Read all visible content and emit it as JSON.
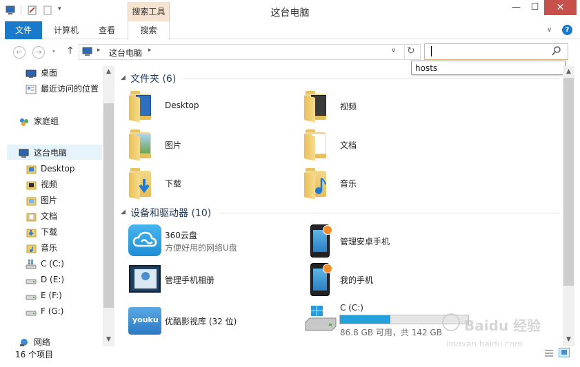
{
  "window": {
    "title": "这台电脑",
    "contextual_tab_group": "搜索工具",
    "controls": {
      "minimize": "—",
      "maximize": "☐",
      "close": "✕"
    }
  },
  "ribbon": {
    "tabs": [
      {
        "label": "文件"
      },
      {
        "label": "计算机"
      },
      {
        "label": "查看"
      },
      {
        "label": "搜索"
      }
    ],
    "help_icon": "?"
  },
  "address": {
    "breadcrumb": [
      "这台电脑"
    ],
    "search_value": "",
    "search_suggestion": "hosts"
  },
  "nav_pane": {
    "items": [
      {
        "label": "桌面",
        "icon": "desktop-icon"
      },
      {
        "label": "最近访问的位置",
        "icon": "recent-places-icon"
      },
      {
        "label": "家庭组",
        "icon": "homegroup-icon"
      },
      {
        "label": "这台电脑",
        "icon": "computer-icon",
        "selected": true
      },
      {
        "label": "Desktop",
        "icon": "folder-icon"
      },
      {
        "label": "视频",
        "icon": "video-folder-icon"
      },
      {
        "label": "图片",
        "icon": "pictures-folder-icon"
      },
      {
        "label": "文档",
        "icon": "documents-folder-icon"
      },
      {
        "label": "下载",
        "icon": "downloads-folder-icon"
      },
      {
        "label": "音乐",
        "icon": "music-folder-icon"
      },
      {
        "label": "C (C:)",
        "icon": "windows-drive-icon"
      },
      {
        "label": "D (E:)",
        "icon": "drive-icon"
      },
      {
        "label": "E (F:)",
        "icon": "drive-icon"
      },
      {
        "label": "F (G:)",
        "icon": "drive-icon"
      },
      {
        "label": "网络",
        "icon": "network-icon"
      }
    ]
  },
  "content": {
    "folders_group": {
      "title": "文件夹 (6)",
      "items": [
        {
          "label": "Desktop",
          "icon": "desktop-folder-icon"
        },
        {
          "label": "视频",
          "icon": "video-folder-icon"
        },
        {
          "label": "图片",
          "icon": "pictures-folder-icon"
        },
        {
          "label": "文档",
          "icon": "documents-folder-icon"
        },
        {
          "label": "下载",
          "icon": "downloads-folder-icon"
        },
        {
          "label": "音乐",
          "icon": "music-folder-icon"
        }
      ]
    },
    "devices_group": {
      "title": "设备和驱动器 (10)",
      "items": [
        {
          "label": "360云盘",
          "sub": "方便好用的网络U盘",
          "icon": "cloud-drive-icon"
        },
        {
          "label": "管理安卓手机",
          "icon": "phone-icon"
        },
        {
          "label": "管理手机相册",
          "icon": "phone-album-icon"
        },
        {
          "label": "我的手机",
          "icon": "phone-icon"
        },
        {
          "label": "优酷影视库 (32 位)",
          "icon": "youku-folder-icon"
        },
        {
          "label": "C (C:)",
          "sub": "86.8 GB 可用，共 142 GB",
          "icon": "windows-drive-icon",
          "used_fraction": 0.39
        }
      ]
    }
  },
  "status": {
    "item_count": "16 个项目"
  },
  "watermark": {
    "line1": "Baidu 经验",
    "line2": "jingyan.baidu.com"
  },
  "colors": {
    "file_tab": "#1979ca",
    "contextual_tab": "#f6e3d0",
    "close_button": "#c7504b",
    "capacity_fill": "#26a0da",
    "group_title": "#1e395b"
  }
}
